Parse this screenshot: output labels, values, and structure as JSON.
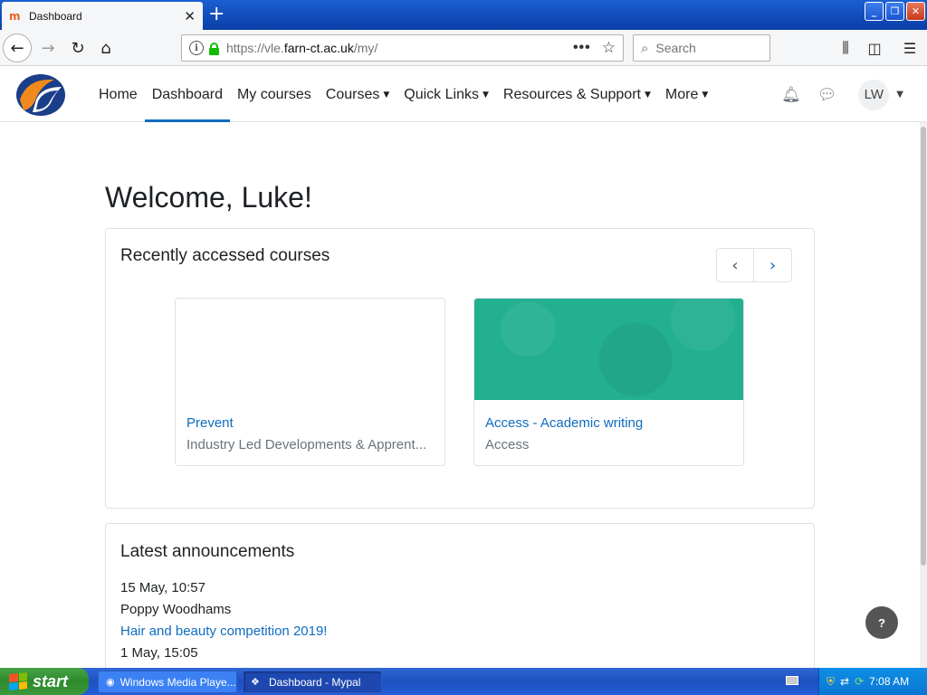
{
  "browser": {
    "tab_title": "Dashboard",
    "tab_close": "✕",
    "new_tab": "+",
    "url_prefix": "https://vle.",
    "url_domain": "farn-ct.ac.uk",
    "url_path": "/my/",
    "page_actions": "•••",
    "search_placeholder": "Search"
  },
  "site": {
    "nav": [
      {
        "label": "Home",
        "dropdown": false
      },
      {
        "label": "Dashboard",
        "dropdown": false,
        "active": true
      },
      {
        "label": "My courses",
        "dropdown": false
      },
      {
        "label": "Courses",
        "dropdown": true
      },
      {
        "label": "Quick Links",
        "dropdown": true
      },
      {
        "label": "Resources & Support",
        "dropdown": true
      },
      {
        "label": "More",
        "dropdown": true
      }
    ],
    "user_initials": "LW",
    "accent_color": "#0f6cbf"
  },
  "main": {
    "welcome": "Welcome, Luke!",
    "recent": {
      "title": "Recently accessed courses",
      "courses": [
        {
          "name": "Prevent",
          "category": "Industry Led Developments & Apprent..."
        },
        {
          "name": "Access - Academic writing",
          "category": "Access"
        }
      ]
    },
    "announcements": {
      "title": "Latest announcements",
      "items": [
        {
          "date": "15 May, 10:57",
          "author": "Poppy Woodhams",
          "subject": "Hair and beauty competition 2019!"
        },
        {
          "date": "1 May, 15:05"
        }
      ]
    },
    "help": "?"
  },
  "taskbar": {
    "start": "start",
    "tasks": [
      {
        "label": "Windows Media Playe...",
        "active": false
      },
      {
        "label": "Dashboard - Mypal",
        "active": true
      }
    ],
    "clock": "7:08 AM"
  }
}
